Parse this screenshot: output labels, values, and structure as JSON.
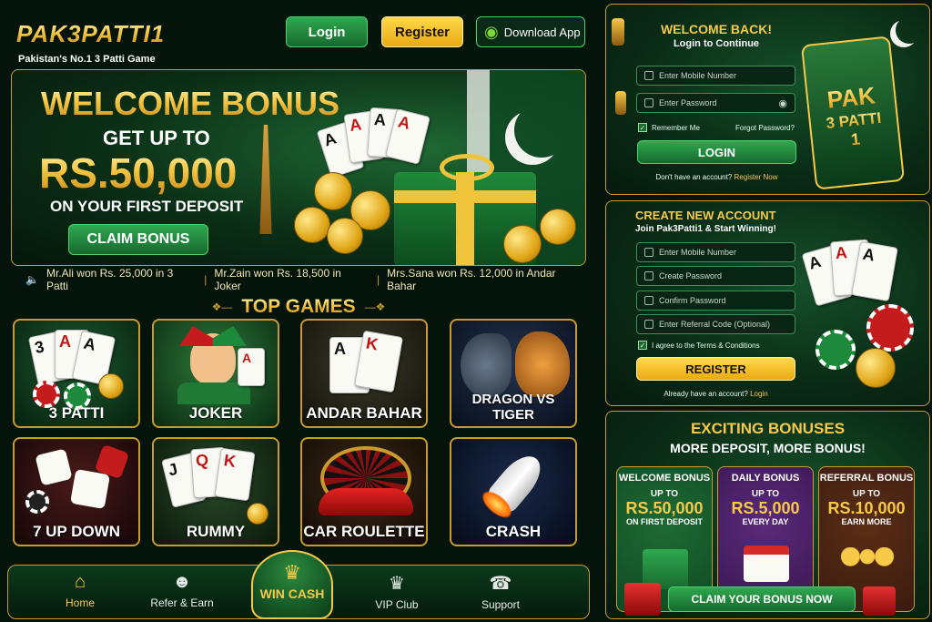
{
  "header": {
    "logo": "PAK3PATTI1",
    "tagline": "Pakistan's No.1 3 Patti Game",
    "login": "Login",
    "register": "Register",
    "download": "Download App"
  },
  "hero": {
    "line1": "WELCOME BONUS",
    "line2": "GET UP TO",
    "line3": "RS.50,000",
    "line4": "ON YOUR FIRST DEPOSIT",
    "cta": "CLAIM BONUS"
  },
  "ticker": {
    "items": [
      "Mr.Ali won Rs. 25,000 in 3 Patti",
      "Mr.Zain won Rs. 18,500 in Joker",
      "Mrs.Sana won Rs. 12,000 in Andar Bahar"
    ]
  },
  "top_games": {
    "title": "TOP GAMES",
    "games": [
      {
        "label": "3 PATTI"
      },
      {
        "label": "JOKER"
      },
      {
        "label": "ANDAR BAHAR"
      },
      {
        "label": "DRAGON VS TIGER"
      },
      {
        "label": "7 UP DOWN"
      },
      {
        "label": "RUMMY"
      },
      {
        "label": "CAR ROULETTE"
      },
      {
        "label": "CRASH"
      }
    ]
  },
  "bottom_nav": {
    "items": [
      {
        "label": "Home",
        "icon": "home-icon",
        "active": true
      },
      {
        "label": "Refer & Earn",
        "icon": "users-icon"
      },
      {
        "label": "WIN CASH",
        "icon": "crown-icon"
      },
      {
        "label": "VIP Club",
        "icon": "crown-icon"
      },
      {
        "label": "Support",
        "icon": "headset-icon"
      }
    ]
  },
  "login_panel": {
    "title": "WELCOME BACK!",
    "subtitle": "Login to Continue",
    "mobile_placeholder": "Enter Mobile Number",
    "password_placeholder": "Enter Password",
    "remember": "Remember Me",
    "forgot": "Forgot Password?",
    "button": "LOGIN",
    "no_account": "Don't have an account?",
    "register_link": "Register Now",
    "badge_line1": "PAK",
    "badge_line2": "3 PATTI",
    "badge_line3": "1"
  },
  "register_panel": {
    "title": "CREATE NEW ACCOUNT",
    "subtitle": "Join Pak3Patti1 & Start Winning!",
    "mobile_placeholder": "Enter Mobile Number",
    "password_placeholder": "Create Password",
    "confirm_placeholder": "Confirm Password",
    "referral_placeholder": "Enter Referral Code (Optional)",
    "terms": "I agree to the Terms & Conditions",
    "button": "REGISTER",
    "have_account": "Already have an account?",
    "login_link": "Login"
  },
  "bonuses": {
    "title": "EXCITING BONUSES",
    "subtitle": "MORE DEPOSIT, MORE BONUS!",
    "cards": [
      {
        "title": "WELCOME BONUS",
        "upto": "UP TO",
        "amount": "RS.50,000",
        "sub": "ON FIRST DEPOSIT",
        "color": "#0f4a22"
      },
      {
        "title": "DAILY BONUS",
        "upto": "UP TO",
        "amount": "RS.5,000",
        "sub": "EVERY DAY",
        "color": "#3a1650"
      },
      {
        "title": "REFERRAL BONUS",
        "upto": "UP TO",
        "amount": "RS.10,000",
        "sub": "EARN MORE",
        "color": "#3a1a0e"
      }
    ],
    "cta": "CLAIM YOUR BONUS NOW"
  },
  "colors": {
    "accent_gold": "#f7c948",
    "brand_green": "#17692e"
  }
}
